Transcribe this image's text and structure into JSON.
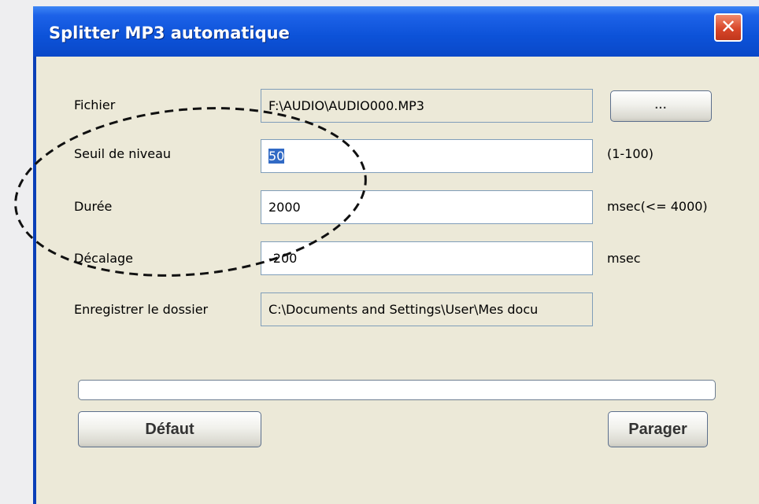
{
  "window": {
    "title": "Splitter MP3 automatique",
    "close_glyph": "✕"
  },
  "form": {
    "file": {
      "label": "Fichier",
      "value": "F:\\AUDIO\\AUDIO000.MP3",
      "browse_label": "..."
    },
    "threshold": {
      "label": "Seuil de niveau",
      "value": "50",
      "hint": "(1-100)"
    },
    "duration": {
      "label": "Durée",
      "value": "2000",
      "hint": "msec(<= 4000)"
    },
    "offset": {
      "label": "Décalage",
      "value": "-200",
      "hint": "msec"
    },
    "save_folder": {
      "label": "Enregistrer le dossier",
      "value": "C:\\Documents and Settings\\User\\Mes docu"
    }
  },
  "progress": {
    "value": 0
  },
  "buttons": {
    "default_label": "Défaut",
    "split_label": "Parager"
  }
}
